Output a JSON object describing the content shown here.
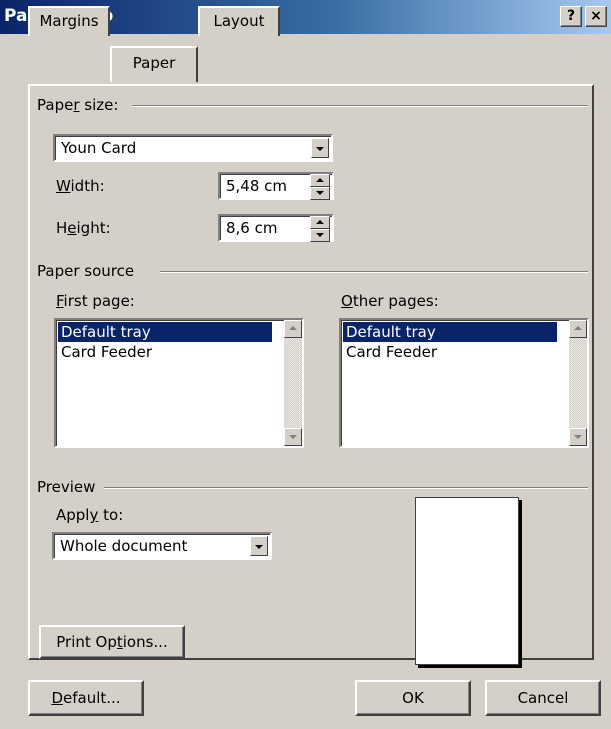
{
  "window": {
    "title": "Page Setup",
    "help_button": "?",
    "close_button": "×"
  },
  "tabs": [
    {
      "label": "Margins",
      "active": false
    },
    {
      "label": "Paper",
      "active": true
    },
    {
      "label": "Layout",
      "active": false
    }
  ],
  "paper_size": {
    "group_label": "Paper size:",
    "selected": "Youn Card",
    "width_label": "Width:",
    "width_value": "5,48 cm",
    "height_label": "Height:",
    "height_value": "8,6 cm"
  },
  "paper_source": {
    "group_label": "Paper source",
    "first_page_label": "First page:",
    "first_page_items": [
      "Default tray",
      "Card Feeder"
    ],
    "first_page_selected": "Default tray",
    "other_pages_label": "Other pages:",
    "other_pages_items": [
      "Default tray",
      "Card Feeder"
    ],
    "other_pages_selected": "Default tray"
  },
  "preview": {
    "group_label": "Preview",
    "apply_to_label": "Apply to:",
    "apply_to_value": "Whole document"
  },
  "buttons": {
    "print_options": "Print Options...",
    "default": "Default...",
    "ok": "OK",
    "cancel": "Cancel"
  },
  "colors": {
    "dialog_bg": "#d4d0c8",
    "title_bar": "#0a246a",
    "selection": "#0a246a"
  }
}
